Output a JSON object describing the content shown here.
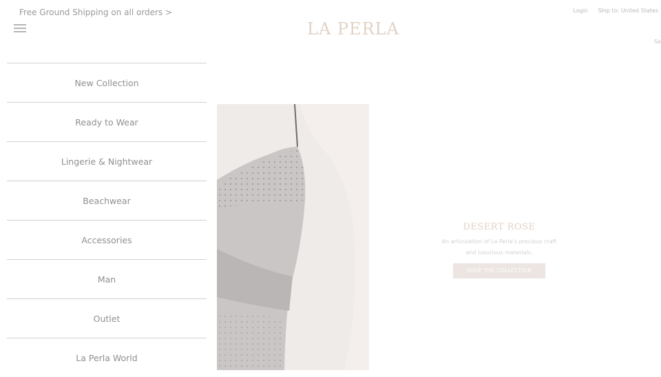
{
  "header": {
    "promo_text": "Free Ground Shipping on all orders >",
    "logo_text": "LA PERLA",
    "login_label": "Login",
    "ship_to_label": "Ship to: United States",
    "search_partial": "Se",
    "menu_icon": "hamburger-menu-icon"
  },
  "sidebar": {
    "items": [
      {
        "label": "New Collection"
      },
      {
        "label": "Ready to Wear"
      },
      {
        "label": "Lingerie & Nightwear"
      },
      {
        "label": "Beachwear"
      },
      {
        "label": "Accessories"
      },
      {
        "label": "Man"
      },
      {
        "label": "Outlet"
      },
      {
        "label": "La Perla World"
      }
    ]
  },
  "promo": {
    "title": "DESERT ROSE",
    "description": "An articulation of La Perla's precious craft and luxurious materials.",
    "cta_label": "SHOP THE COLLECTION"
  },
  "colors": {
    "logo": "#e3d2c5",
    "nav_text": "#8f8f8f",
    "divider": "#d0d0d0",
    "cta_bg": "#ece5e1"
  }
}
